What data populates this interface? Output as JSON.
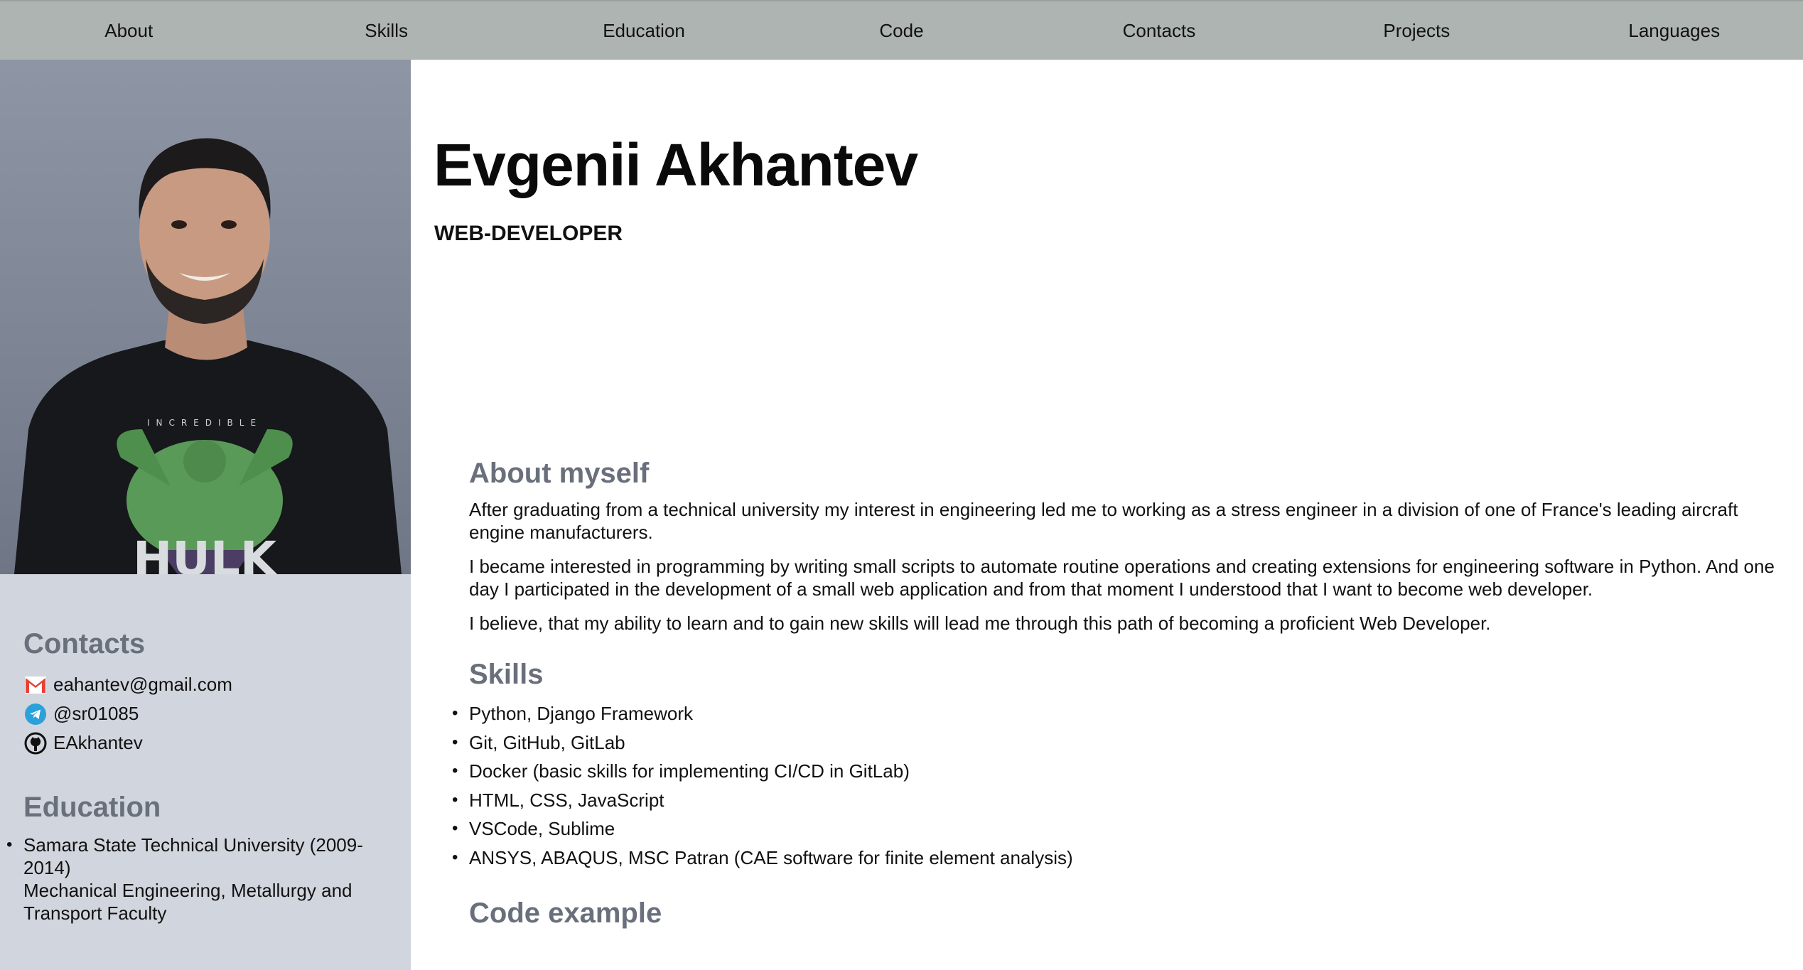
{
  "nav": {
    "items": [
      "About",
      "Skills",
      "Education",
      "Code",
      "Contacts",
      "Projects",
      "Languages"
    ]
  },
  "profile": {
    "name": "Evgenii Akhantev",
    "role": "WEB-DEVELOPER",
    "photo_shirt_text_top": "INCREDIBLE",
    "photo_shirt_text": "HULK"
  },
  "sidebar": {
    "contacts_title": "Contacts",
    "contacts": [
      {
        "icon": "gmail-icon",
        "text": "eahantev@gmail.com"
      },
      {
        "icon": "telegram-icon",
        "text": "@sr01085"
      },
      {
        "icon": "github-icon",
        "text": "EAkhantev"
      }
    ],
    "education_title": "Education",
    "education": [
      {
        "line1": "Samara State Technical University (2009-2014)",
        "line2": "Mechanical Engineering, Metallurgy and Transport Faculty"
      }
    ]
  },
  "about": {
    "title": "About myself",
    "paragraphs": [
      "After graduating from a technical university my interest in engineering led me to working as a stress engineer in a division of one of France's leading aircraft engine manufacturers.",
      "I became interested in programming by writing small scripts to automate routine operations and creating extensions for engineering software in Python. And one day I participated in the development of a small web application and from that moment I understood that I want to become web developer.",
      "I believe, that my ability to learn and to gain new skills will lead me through this path of becoming a proficient Web Developer."
    ]
  },
  "skills": {
    "title": "Skills",
    "items": [
      "Python, Django Framework",
      "Git, GitHub, GitLab",
      "Docker (basic skills for implementing CI/CD in GitLab)",
      "HTML, CSS, JavaScript",
      "VSCode, Sublime",
      "ANSYS, ABAQUS, MSC Patran (CAE software for finite element analysis)"
    ]
  },
  "code": {
    "title": "Code example"
  },
  "colors": {
    "nav_bg": "#aeb4b2",
    "sidebar_bg": "#d1d5de",
    "heading": "#6a6f7c"
  }
}
